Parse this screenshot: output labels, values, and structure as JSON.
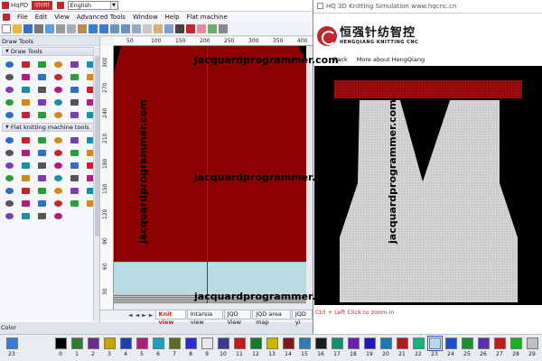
{
  "titlebar": {
    "app_title": "HqPD",
    "lang_tag": "বাংলা",
    "language": "English"
  },
  "menu": [
    "File",
    "Edit",
    "View",
    "Advanced Tools",
    "Window",
    "Help",
    "Flat machine"
  ],
  "left_panel": {
    "title": "Draw Tools",
    "section_draw": "Draw Tools",
    "section_flat": "Flat knitting machine tools"
  },
  "ruler": {
    "top": [
      "50",
      "100",
      "150",
      "200",
      "250",
      "300",
      "350",
      "400"
    ],
    "left": [
      "300",
      "270",
      "240",
      "210",
      "180",
      "150",
      "120",
      "90",
      "60",
      "30"
    ]
  },
  "tabs": [
    "Knit view",
    "Intarsia view",
    "JQD View",
    "JQD area map",
    "JQD yi"
  ],
  "tab_nav": [
    "◄",
    "◄",
    "►",
    "►"
  ],
  "sim": {
    "window_title": "HQ 3D Knitting Simulation",
    "window_url": "www.hqcnc.cn",
    "brand_cn": "恒强针纺智控",
    "brand_en": "HENGQIANG KNITTING CNC",
    "link_back": "Back",
    "link_about": "More about HengQiang",
    "hint": "Ctrl + Left Click to zoom-in"
  },
  "watermark": "jacquardprogrammer.com",
  "colorbar": {
    "label": "Color",
    "first_number": "23",
    "selected": "23",
    "swatches": [
      {
        "n": "0",
        "c": "#000000"
      },
      {
        "n": "1",
        "c": "#2e7d32"
      },
      {
        "n": "2",
        "c": "#6d2b8e"
      },
      {
        "n": "3",
        "c": "#c8a400"
      },
      {
        "n": "4",
        "c": "#1f3fb3"
      },
      {
        "n": "5",
        "c": "#b01d7a"
      },
      {
        "n": "6",
        "c": "#1fa0b8"
      },
      {
        "n": "7",
        "c": "#5a6b2a"
      },
      {
        "n": "8",
        "c": "#2b2bd1"
      },
      {
        "n": "9",
        "c": "#e8e8e8"
      },
      {
        "n": "10",
        "c": "#3b3b8f"
      },
      {
        "n": "11",
        "c": "#c01c1c"
      },
      {
        "n": "12",
        "c": "#157a2f"
      },
      {
        "n": "13",
        "c": "#c8b800"
      },
      {
        "n": "14",
        "c": "#7a1c1c"
      },
      {
        "n": "15",
        "c": "#2f7ab8"
      },
      {
        "n": "16",
        "c": "#1c1c1c"
      },
      {
        "n": "17",
        "c": "#0f8f6a"
      },
      {
        "n": "18",
        "c": "#6f1cb0"
      },
      {
        "n": "19",
        "c": "#1c1cb0"
      },
      {
        "n": "20",
        "c": "#1c7ab0"
      },
      {
        "n": "21",
        "c": "#b01c1c"
      },
      {
        "n": "22",
        "c": "#1cb07a"
      },
      {
        "n": "23",
        "c": "#b7d7f0"
      },
      {
        "n": "24",
        "c": "#1c4fd1"
      },
      {
        "n": "25",
        "c": "#1c8f2f"
      },
      {
        "n": "26",
        "c": "#5a2fb0"
      },
      {
        "n": "27",
        "c": "#c01c1c"
      },
      {
        "n": "28",
        "c": "#1cb01c"
      },
      {
        "n": "29",
        "c": "#c0c0c0"
      },
      {
        "n": "30",
        "c": "#1c1cd1"
      }
    ]
  },
  "colors": {
    "accent": "#c1272d",
    "design_red": "#8b0000",
    "design_light": "#b9dce3"
  }
}
